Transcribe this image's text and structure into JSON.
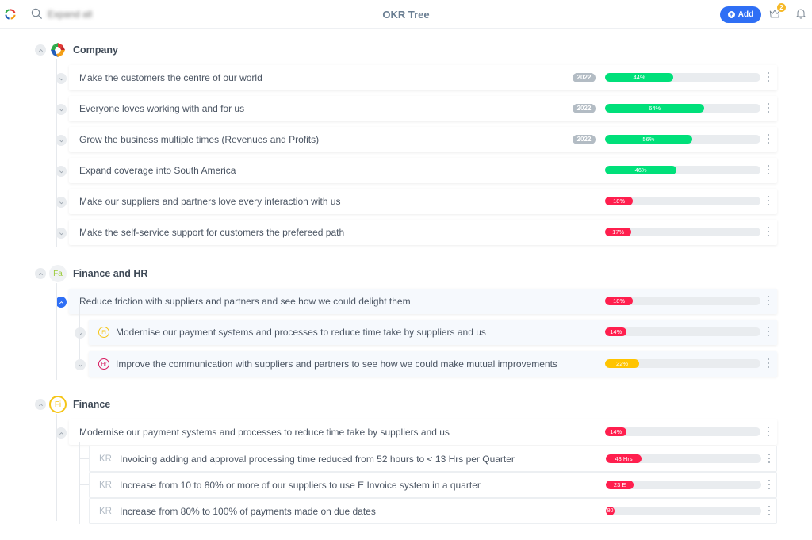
{
  "header": {
    "title": "OKR Tree",
    "search_placeholder": "Expand all",
    "add_label": "Add",
    "notification_count": "2"
  },
  "colors": {
    "accent": "#2f6ff5",
    "green": "#00e07a",
    "red": "#ff1f4e",
    "yellow": "#ffc400",
    "badge": "#f6b928"
  },
  "groups": [
    {
      "title": "Company",
      "avatar": "company-logo",
      "objectives": [
        {
          "text": "Make the customers the centre of our world",
          "year": "2022",
          "progress": 44,
          "label": "44%",
          "status": "green"
        },
        {
          "text": "Everyone loves working with and for us",
          "year": "2022",
          "progress": 64,
          "label": "64%",
          "status": "green"
        },
        {
          "text": "Grow the business multiple times (Revenues and Profits)",
          "year": "2022",
          "progress": 56,
          "label": "56%",
          "status": "green"
        },
        {
          "text": "Expand coverage into South America",
          "year": "",
          "progress": 46,
          "label": "46%",
          "status": "green"
        },
        {
          "text": "Make our suppliers and partners love every interaction with us",
          "year": "",
          "progress": 18,
          "label": "18%",
          "status": "red"
        },
        {
          "text": "Make the self-service support for customers the prefereed path",
          "year": "",
          "progress": 17,
          "label": "17%",
          "status": "red"
        }
      ]
    },
    {
      "title": "Finance and HR",
      "avatar": "Fa",
      "objectives": [
        {
          "text": "Reduce friction with suppliers and partners and see how we could delight them",
          "progress": 18,
          "label": "18%",
          "status": "red",
          "children": [
            {
              "avatar": "Fi",
              "text": "Modernise our payment systems and processes to reduce time take by suppliers and us",
              "progress": 14,
              "label": "14%",
              "status": "red"
            },
            {
              "avatar": "Hr",
              "text": "Improve the communication with suppliers and partners to see how we could make mutual improvements",
              "progress": 22,
              "label": "22%",
              "status": "yellow"
            }
          ]
        }
      ]
    },
    {
      "title": "Finance",
      "avatar": "Fi",
      "objectives": [
        {
          "text": "Modernise our payment systems and processes to reduce time take by suppliers and us",
          "progress": 14,
          "label": "14%",
          "status": "red",
          "key_results": [
            {
              "tag": "KR",
              "text": "Invoicing adding and approval processing time reduced from 52 hours to < 13 Hrs per Quarter",
              "progress": 23,
              "label": "43 Hrs",
              "status": "red"
            },
            {
              "tag": "KR",
              "text": "Increase from 10 to 80% or more of our suppliers to use E Invoice system in a quarter",
              "progress": 18,
              "label": "23 E",
              "status": "red"
            },
            {
              "tag": "KR",
              "text": "Increase from 80% to 100% of payments made on due dates",
              "progress": 0,
              "label": "80",
              "status": "red"
            }
          ]
        }
      ]
    }
  ]
}
